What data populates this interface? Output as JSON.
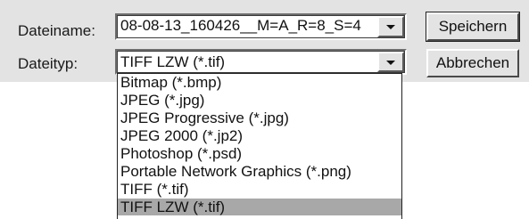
{
  "dialog": {
    "filename_label": "Dateiname:",
    "filename_value": "08-08-13_160426__M=A_R=8_S=4",
    "filetype_label": "Dateityp:",
    "filetype_value": "TIFF LZW (*.tif)",
    "save_label": "Speichern",
    "cancel_label": "Abbrechen"
  },
  "filetype_options": [
    "Bitmap (*.bmp)",
    "JPEG (*.jpg)",
    "JPEG Progressive (*.jpg)",
    "JPEG 2000 (*.jp2)",
    "Photoshop (*.psd)",
    "Portable Network Graphics (*.png)",
    "TIFF (*.tif)",
    "TIFF LZW (*.tif)"
  ],
  "selected_option": "TIFF LZW (*.tif)",
  "colors": {
    "dialog_background": "#e3e3e3",
    "selection_highlight": "#a8a8a8"
  }
}
